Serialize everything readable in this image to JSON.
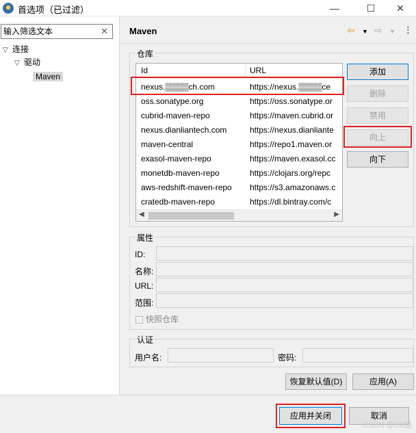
{
  "window": {
    "title": "首选项（已过滤）",
    "controls": [
      "—",
      "☐",
      "✕"
    ]
  },
  "filter": {
    "placeholder": "输入筛选文本"
  },
  "tree": [
    {
      "label": "连接"
    },
    {
      "label": "驱动"
    },
    {
      "label": "Maven"
    }
  ],
  "page": {
    "title": "Maven"
  },
  "repo_group": {
    "label": "仓库",
    "columns": [
      "Id",
      "URL"
    ],
    "rows": [
      {
        "id": "nexus.▒▒▒▒ch.com",
        "url": "https://nexus.▒▒▒▒ce"
      },
      {
        "id": "oss.sonatype.org",
        "url": "https://oss.sonatype.or"
      },
      {
        "id": "cubrid-maven-repo",
        "url": "https://maven.cubrid.or"
      },
      {
        "id": "nexus.dianliantech.com",
        "url": "https://nexus.dianliante"
      },
      {
        "id": "maven-central",
        "url": "https://repo1.maven.or"
      },
      {
        "id": "exasol-maven-repo",
        "url": "https://maven.exasol.cc"
      },
      {
        "id": "monetdb-maven-repo",
        "url": "https://clojars.org/repc"
      },
      {
        "id": "aws-redshift-maven-repo",
        "url": "https://s3.amazonaws.c"
      },
      {
        "id": "cratedb-maven-repo",
        "url": "https://dl.bintray.com/c"
      }
    ],
    "buttons": {
      "add": "添加",
      "delete": "删除",
      "disable": "禁用",
      "up": "向上",
      "down": "向下"
    }
  },
  "props_group": {
    "label": "属性",
    "fields": [
      "ID:",
      "名称:",
      "URL:",
      "范围:"
    ],
    "snapshot_label": "快照仓库"
  },
  "auth_group": {
    "label": "认证",
    "username_label": "用户名:",
    "password_label": "密码:"
  },
  "actions": {
    "restore": "恢复默认值(D)",
    "apply": "应用(A)",
    "apply_close": "应用并关闭",
    "cancel": "取消"
  },
  "watermark": "CSDN @CK姐",
  "colors": {
    "highlight": "#e02020",
    "focus": "#0078d7"
  }
}
